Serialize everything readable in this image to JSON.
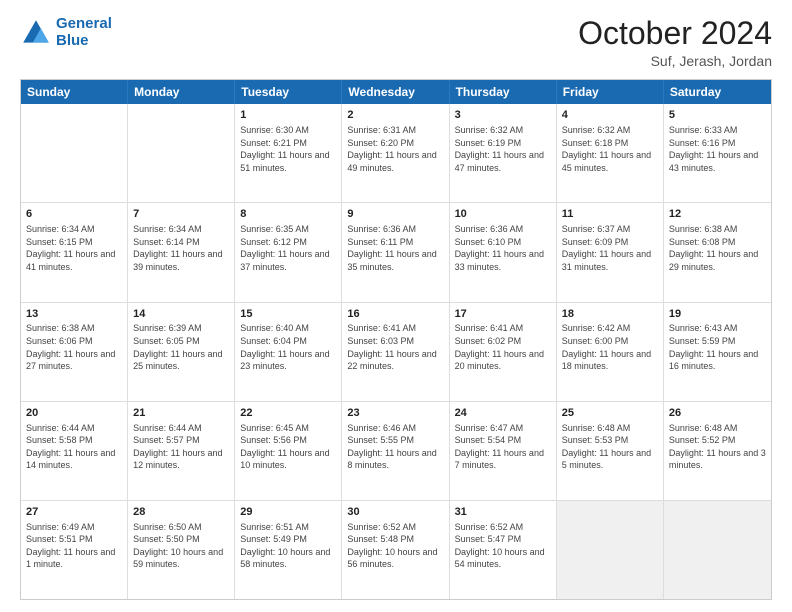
{
  "header": {
    "logo_line1": "General",
    "logo_line2": "Blue",
    "month_title": "October 2024",
    "location": "Suf, Jerash, Jordan"
  },
  "days_of_week": [
    "Sunday",
    "Monday",
    "Tuesday",
    "Wednesday",
    "Thursday",
    "Friday",
    "Saturday"
  ],
  "rows": [
    [
      {
        "day": "",
        "info": ""
      },
      {
        "day": "",
        "info": ""
      },
      {
        "day": "1",
        "info": "Sunrise: 6:30 AM\nSunset: 6:21 PM\nDaylight: 11 hours and 51 minutes."
      },
      {
        "day": "2",
        "info": "Sunrise: 6:31 AM\nSunset: 6:20 PM\nDaylight: 11 hours and 49 minutes."
      },
      {
        "day": "3",
        "info": "Sunrise: 6:32 AM\nSunset: 6:19 PM\nDaylight: 11 hours and 47 minutes."
      },
      {
        "day": "4",
        "info": "Sunrise: 6:32 AM\nSunset: 6:18 PM\nDaylight: 11 hours and 45 minutes."
      },
      {
        "day": "5",
        "info": "Sunrise: 6:33 AM\nSunset: 6:16 PM\nDaylight: 11 hours and 43 minutes."
      }
    ],
    [
      {
        "day": "6",
        "info": "Sunrise: 6:34 AM\nSunset: 6:15 PM\nDaylight: 11 hours and 41 minutes."
      },
      {
        "day": "7",
        "info": "Sunrise: 6:34 AM\nSunset: 6:14 PM\nDaylight: 11 hours and 39 minutes."
      },
      {
        "day": "8",
        "info": "Sunrise: 6:35 AM\nSunset: 6:12 PM\nDaylight: 11 hours and 37 minutes."
      },
      {
        "day": "9",
        "info": "Sunrise: 6:36 AM\nSunset: 6:11 PM\nDaylight: 11 hours and 35 minutes."
      },
      {
        "day": "10",
        "info": "Sunrise: 6:36 AM\nSunset: 6:10 PM\nDaylight: 11 hours and 33 minutes."
      },
      {
        "day": "11",
        "info": "Sunrise: 6:37 AM\nSunset: 6:09 PM\nDaylight: 11 hours and 31 minutes."
      },
      {
        "day": "12",
        "info": "Sunrise: 6:38 AM\nSunset: 6:08 PM\nDaylight: 11 hours and 29 minutes."
      }
    ],
    [
      {
        "day": "13",
        "info": "Sunrise: 6:38 AM\nSunset: 6:06 PM\nDaylight: 11 hours and 27 minutes."
      },
      {
        "day": "14",
        "info": "Sunrise: 6:39 AM\nSunset: 6:05 PM\nDaylight: 11 hours and 25 minutes."
      },
      {
        "day": "15",
        "info": "Sunrise: 6:40 AM\nSunset: 6:04 PM\nDaylight: 11 hours and 23 minutes."
      },
      {
        "day": "16",
        "info": "Sunrise: 6:41 AM\nSunset: 6:03 PM\nDaylight: 11 hours and 22 minutes."
      },
      {
        "day": "17",
        "info": "Sunrise: 6:41 AM\nSunset: 6:02 PM\nDaylight: 11 hours and 20 minutes."
      },
      {
        "day": "18",
        "info": "Sunrise: 6:42 AM\nSunset: 6:00 PM\nDaylight: 11 hours and 18 minutes."
      },
      {
        "day": "19",
        "info": "Sunrise: 6:43 AM\nSunset: 5:59 PM\nDaylight: 11 hours and 16 minutes."
      }
    ],
    [
      {
        "day": "20",
        "info": "Sunrise: 6:44 AM\nSunset: 5:58 PM\nDaylight: 11 hours and 14 minutes."
      },
      {
        "day": "21",
        "info": "Sunrise: 6:44 AM\nSunset: 5:57 PM\nDaylight: 11 hours and 12 minutes."
      },
      {
        "day": "22",
        "info": "Sunrise: 6:45 AM\nSunset: 5:56 PM\nDaylight: 11 hours and 10 minutes."
      },
      {
        "day": "23",
        "info": "Sunrise: 6:46 AM\nSunset: 5:55 PM\nDaylight: 11 hours and 8 minutes."
      },
      {
        "day": "24",
        "info": "Sunrise: 6:47 AM\nSunset: 5:54 PM\nDaylight: 11 hours and 7 minutes."
      },
      {
        "day": "25",
        "info": "Sunrise: 6:48 AM\nSunset: 5:53 PM\nDaylight: 11 hours and 5 minutes."
      },
      {
        "day": "26",
        "info": "Sunrise: 6:48 AM\nSunset: 5:52 PM\nDaylight: 11 hours and 3 minutes."
      }
    ],
    [
      {
        "day": "27",
        "info": "Sunrise: 6:49 AM\nSunset: 5:51 PM\nDaylight: 11 hours and 1 minute."
      },
      {
        "day": "28",
        "info": "Sunrise: 6:50 AM\nSunset: 5:50 PM\nDaylight: 10 hours and 59 minutes."
      },
      {
        "day": "29",
        "info": "Sunrise: 6:51 AM\nSunset: 5:49 PM\nDaylight: 10 hours and 58 minutes."
      },
      {
        "day": "30",
        "info": "Sunrise: 6:52 AM\nSunset: 5:48 PM\nDaylight: 10 hours and 56 minutes."
      },
      {
        "day": "31",
        "info": "Sunrise: 6:52 AM\nSunset: 5:47 PM\nDaylight: 10 hours and 54 minutes."
      },
      {
        "day": "",
        "info": ""
      },
      {
        "day": "",
        "info": ""
      }
    ]
  ]
}
